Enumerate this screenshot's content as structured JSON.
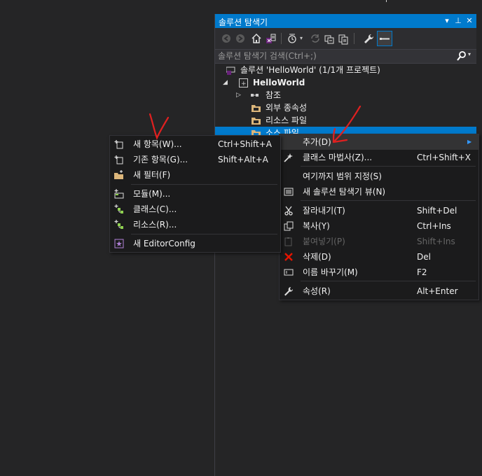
{
  "panel": {
    "title": "솔루션 탐색기",
    "title_buttons": {
      "dropdown": "▾",
      "pin": "⊥",
      "close": "✕"
    }
  },
  "search": {
    "placeholder": "솔루션 탐색기 검색(Ctrl+;)"
  },
  "tree": {
    "solution": "솔루션 'HelloWorld' (1/1개 프로젝트)",
    "project": "HelloWorld",
    "references": "참조",
    "external": "외부 종속성",
    "resource": "리소스 파일",
    "source": "소스 파일"
  },
  "context_menu": {
    "items": [
      {
        "label": "추가(D)",
        "shortcut": "",
        "icon": "none",
        "disabled": false,
        "submenu": true
      },
      {
        "label": "클래스 마법사(Z)...",
        "shortcut": "Ctrl+Shift+X",
        "icon": "class-wizard-icon",
        "disabled": false
      },
      {
        "label": "여기까지 범위 지정(S)",
        "shortcut": "",
        "icon": "none",
        "disabled": false
      },
      {
        "label": "새 솔루션 탐색기 뷰(N)",
        "shortcut": "",
        "icon": "new-view-icon",
        "disabled": false
      },
      {
        "label": "잘라내기(T)",
        "shortcut": "Shift+Del",
        "icon": "scissors-icon",
        "disabled": false
      },
      {
        "label": "복사(Y)",
        "shortcut": "Ctrl+Ins",
        "icon": "copy-icon",
        "disabled": false
      },
      {
        "label": "붙여넣기(P)",
        "shortcut": "Shift+Ins",
        "icon": "paste-icon",
        "disabled": true
      },
      {
        "label": "삭제(D)",
        "shortcut": "Del",
        "icon": "delete-icon",
        "disabled": false
      },
      {
        "label": "이름 바꾸기(M)",
        "shortcut": "F2",
        "icon": "rename-icon",
        "disabled": false
      },
      {
        "label": "속성(R)",
        "shortcut": "Alt+Enter",
        "icon": "wrench-icon",
        "disabled": false
      }
    ]
  },
  "submenu": {
    "items": [
      {
        "label": "새 항목(W)...",
        "shortcut": "Ctrl+Shift+A",
        "icon": "new-item-icon"
      },
      {
        "label": "기존 항목(G)...",
        "shortcut": "Shift+Alt+A",
        "icon": "existing-item-icon"
      },
      {
        "label": "새 필터(F)",
        "shortcut": "",
        "icon": "new-filter-icon"
      },
      {
        "label": "모듈(M)...",
        "shortcut": "",
        "icon": "module-icon"
      },
      {
        "label": "클래스(C)...",
        "shortcut": "",
        "icon": "class-icon"
      },
      {
        "label": "리소스(R)...",
        "shortcut": "",
        "icon": "resource-icon"
      },
      {
        "label": "새 EditorConfig",
        "shortcut": "",
        "icon": "editorconfig-icon"
      }
    ]
  },
  "colors": {
    "accent": "#007acc",
    "background": "#252526",
    "menu_bg": "#1b1b1c",
    "annotation": "#e02020"
  }
}
